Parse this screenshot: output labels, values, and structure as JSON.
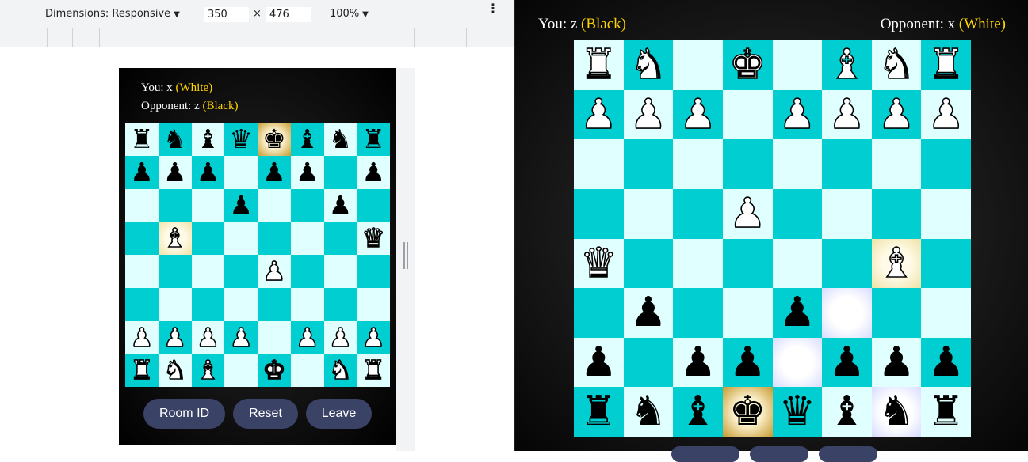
{
  "devtools": {
    "dimensions_label": "Dimensions: Responsive",
    "width_value": "350",
    "times": "×",
    "height_value": "476",
    "zoom_label": "100%",
    "more_icon": "⋮"
  },
  "mini_app": {
    "you_prefix": "You: x ",
    "you_color": "(White)",
    "opponent_prefix": "Opponent: z ",
    "opponent_color": "(Black)",
    "buttons": {
      "room_id": "Room ID",
      "reset": "Reset",
      "leave": "Leave"
    },
    "board": [
      [
        "bR",
        "bN",
        "bB",
        "bQ",
        "bK",
        "bB",
        "bN",
        "bR"
      ],
      [
        "bP",
        "bP",
        "bP",
        "",
        "bP",
        "bP",
        "",
        "bP"
      ],
      [
        "",
        "",
        "",
        "bP",
        "",
        "",
        "bP",
        ""
      ],
      [
        "",
        "wB",
        "",
        "",
        "",
        "",
        "",
        "wQ"
      ],
      [
        "",
        "",
        "",
        "",
        "wP",
        "",
        "",
        ""
      ],
      [
        "",
        "",
        "",
        "",
        "",
        "",
        "",
        ""
      ],
      [
        "wP",
        "wP",
        "wP",
        "wP",
        "",
        "wP",
        "wP",
        "wP"
      ],
      [
        "wR",
        "wN",
        "wB",
        "",
        "wK",
        "",
        "wN",
        "wR"
      ]
    ],
    "highlights": {
      "0-4": "gold",
      "3-1": "pale"
    }
  },
  "app": {
    "you_prefix": "You: z ",
    "you_color": "(Black)",
    "opponent_prefix": "Opponent: x ",
    "opponent_color": "(White)",
    "board": [
      [
        "wR",
        "wN",
        "",
        "wK",
        "",
        "wB",
        "wN",
        "wR"
      ],
      [
        "wP",
        "wP",
        "wP",
        "",
        "wP",
        "wP",
        "wP",
        "wP"
      ],
      [
        "",
        "",
        "",
        "",
        "",
        "",
        "",
        ""
      ],
      [
        "",
        "",
        "",
        "wP",
        "",
        "",
        "",
        ""
      ],
      [
        "wQ",
        "",
        "",
        "",
        "",
        "",
        "wB",
        ""
      ],
      [
        "",
        "bP",
        "",
        "",
        "bP",
        "",
        "",
        ""
      ],
      [
        "bP",
        "",
        "bP",
        "bP",
        "",
        "bP",
        "bP",
        "bP"
      ],
      [
        "bR",
        "bN",
        "bB",
        "bK",
        "bQ",
        "bB",
        "bN",
        "bR"
      ]
    ],
    "highlights": {
      "7-3": "gold",
      "4-6": "pale",
      "5-5": "move",
      "6-4": "move",
      "7-6": "move"
    }
  },
  "pieces": {
    "K": "♚",
    "Q": "♛",
    "R": "♜",
    "B": "♝",
    "N": "♞",
    "P": "♟"
  },
  "colors": {
    "light_square": "#e0ffff",
    "dark_square": "#00ced1",
    "player_color_text": "#ffd500",
    "button_bg": "#3a4266"
  }
}
